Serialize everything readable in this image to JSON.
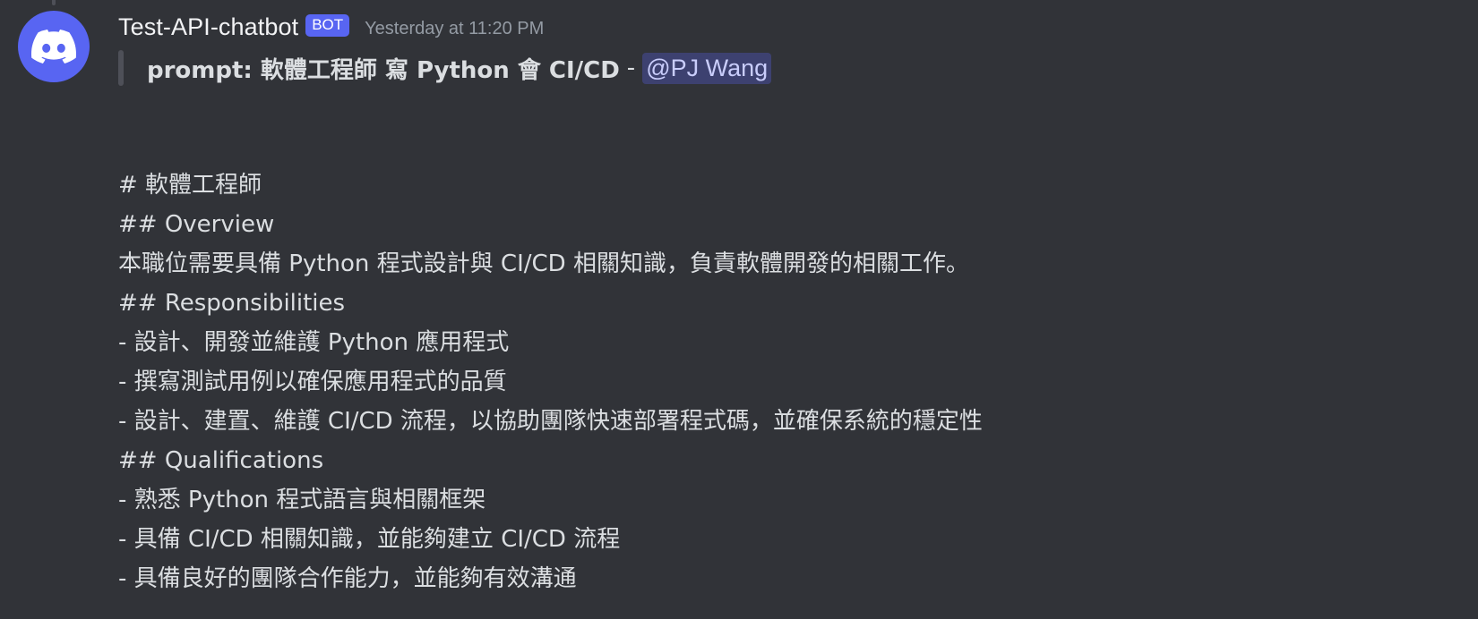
{
  "message": {
    "author": "Test-API-chatbot",
    "bot_tag": "BOT",
    "timestamp": "Yesterday at 11:20 PM",
    "quote": {
      "prompt": "prompt: 軟體工程師 寫 Python 會 CI/CD",
      "separator": "-",
      "mention": "@PJ Wang"
    },
    "lines": [
      "# 軟體工程師",
      "## Overview",
      "本職位需要具備 Python 程式設計與 CI/CD 相關知識，負責軟體開發的相關工作。",
      "## Responsibilities",
      "- 設計、開發並維護 Python 應用程式",
      "- 撰寫測試用例以確保應用程式的品質",
      "- 設計、建置、維護 CI/CD 流程，以協助團隊快速部署程式碼，並確保系統的穩定性",
      "## Qualifications",
      "- 熟悉 Python 程式語言與相關框架",
      "- 具備 CI/CD 相關知識，並能夠建立 CI/CD 流程",
      "- 具備良好的團隊合作能力，並能夠有效溝通"
    ]
  },
  "icons": {
    "avatar": "discord-logo-icon"
  },
  "colors": {
    "background": "#313338",
    "avatar_bg": "#5865f2",
    "bot_tag": "#5865f2",
    "mention_bg": "rgba(88,101,242,0.3)",
    "text": "#dbdee1",
    "timestamp": "#949ba4"
  }
}
